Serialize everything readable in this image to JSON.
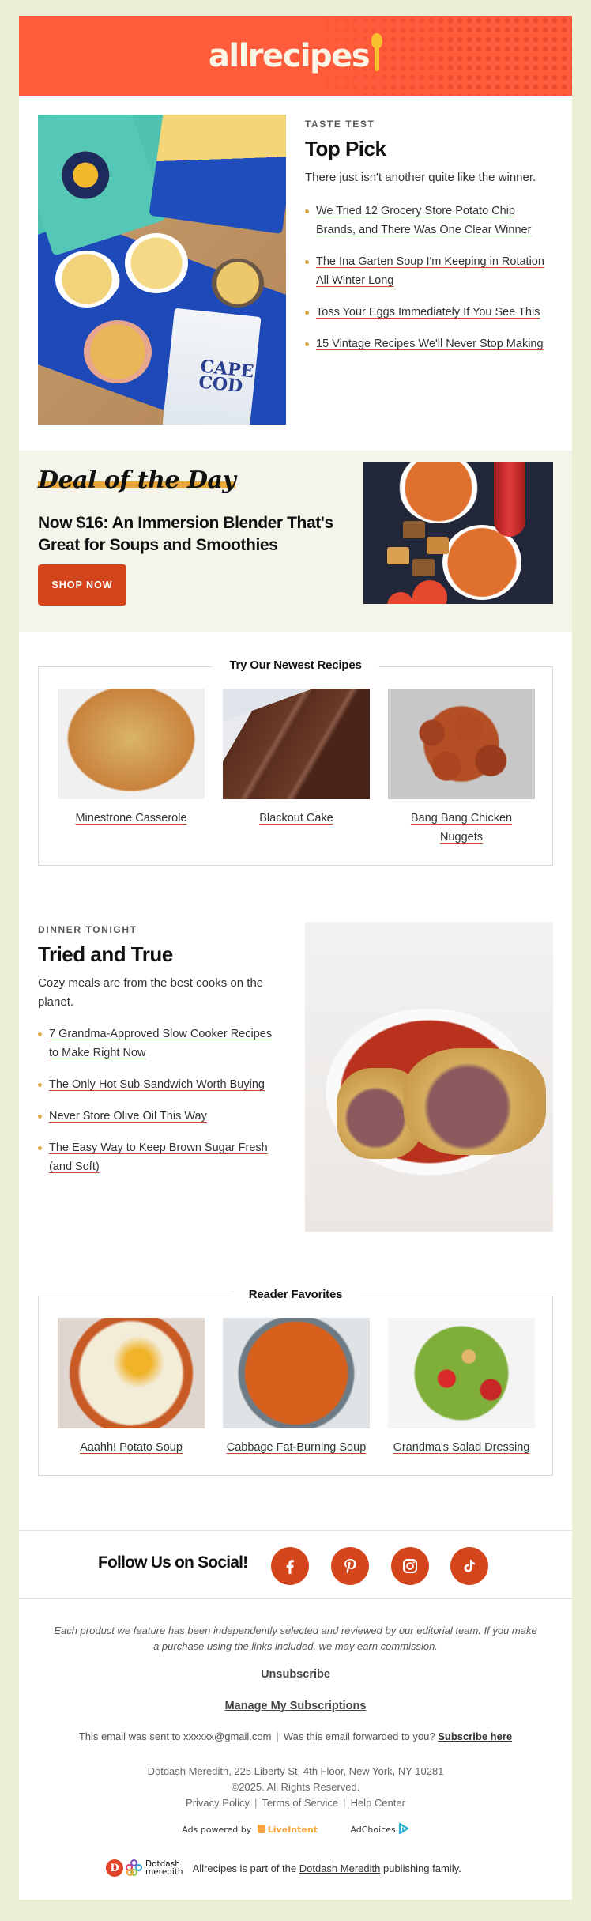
{
  "header": {
    "logo_text": "allrecipes",
    "brand_color": "#FF5C3C"
  },
  "top_pick": {
    "image_alt": "Bowls of potato chips with chip bags on a wooden table",
    "kicker": "TASTE TEST",
    "title": "Top Pick",
    "dek": "There just isn't another quite like the winner.",
    "links": [
      "We Tried 12 Grocery Store Potato Chip Brands, and There Was One Clear Winner",
      "The Ina Garten Soup I'm Keeping in Rotation All Winter Long",
      "Toss Your Eggs Immediately If You See This",
      "15 Vintage Recipes We'll Never Stop Making"
    ]
  },
  "deal": {
    "title": "Deal of the Day",
    "headline": "Now $16: An Immersion Blender That's Great for Soups and Smoothies",
    "button": "SHOP NOW",
    "image_alt": "Tomato soup bowls with grilled cheese croutons and a red immersion blender",
    "accent_color": "#D4451B"
  },
  "newest": {
    "title": "Try Our Newest Recipes",
    "items": [
      {
        "label": "Minestrone Casserole"
      },
      {
        "label": "Blackout Cake"
      },
      {
        "label": "Bang Bang Chicken Nuggets"
      }
    ]
  },
  "dinner": {
    "kicker": "DINNER TONIGHT",
    "title": "Tried and True",
    "dek": "Cozy meals are from the best cooks on the planet.",
    "links": [
      "7 Grandma-Approved Slow Cooker Recipes to Make Right Now",
      "The Only Hot Sub Sandwich Worth Buying",
      "Never Store Olive Oil This Way",
      "The Easy Way to Keep Brown Sugar Fresh (and Soft)"
    ],
    "image_alt": "Stuffed cabbage rolls in tomato broth in a white bowl"
  },
  "favorites": {
    "title": "Reader Favorites",
    "items": [
      {
        "label": "Aaahh! Potato Soup"
      },
      {
        "label": "Cabbage Fat-Burning Soup"
      },
      {
        "label": "Grandma's Salad Dressing"
      }
    ]
  },
  "social": {
    "label": "Follow Us on Social!",
    "networks": [
      "facebook",
      "pinterest",
      "instagram",
      "tiktok"
    ]
  },
  "footer": {
    "disclaimer": "Each product we feature has been independently selected and reviewed by our editorial team. If you make a purchase using the links included, we may earn commission.",
    "unsubscribe": "Unsubscribe",
    "manage": "Manage My Subscriptions",
    "sent_prefix": "This email was sent to xxxxxx@gmail.com",
    "forwarded": "Was this email forwarded to you?",
    "subscribe_here": "Subscribe here",
    "address": "Dotdash Meredith, 225 Liberty St, 4th Floor, New York, NY 10281",
    "copyright": "©2025. All Rights Reserved.",
    "legal_links": [
      "Privacy Policy",
      "Terms of Service",
      "Help Center"
    ],
    "ads_powered_by": "Ads powered by",
    "liveintent": "LiveIntent",
    "adchoices": "AdChoices",
    "family_logo_line1": "Dotdash",
    "family_logo_line2": "meredith",
    "family_prefix": "Allrecipes is part of the",
    "family_link": "Dotdash Meredith",
    "family_suffix": "publishing family."
  }
}
